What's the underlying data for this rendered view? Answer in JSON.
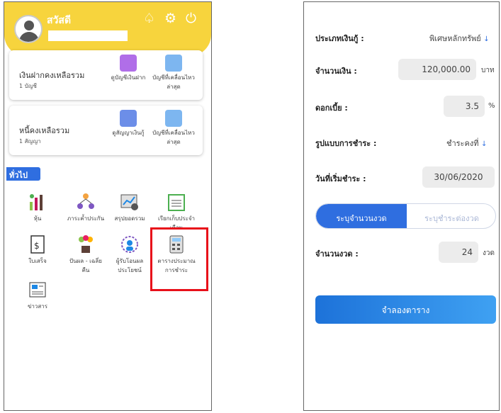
{
  "left": {
    "greeting": "สวัสดี",
    "header_icons": [
      "bell-icon",
      "gear-icon",
      "power-icon"
    ],
    "deposit_card": {
      "title": "เงินฝากคงเหลือรวม",
      "subtitle": "1 บัญชี",
      "action1": "ดูบัญชีเงินฝาก",
      "action2_line1": "บัญชีที่เคลื่อนไหว",
      "action2_line2": "ล่าสุด"
    },
    "loan_card": {
      "title": "หนี้คงเหลือรวม",
      "subtitle": "1 สัญญา",
      "action1": "ดูสัญญาเงินกู้",
      "action2_line1": "บัญชีที่เคลื่อนไหว",
      "action2_line2": "ล่าสุด"
    },
    "section_label": "ทั่วไป",
    "menu": [
      {
        "l1": "หุ้น",
        "l2": ""
      },
      {
        "l1": "ภาระค้ำประกัน",
        "l2": ""
      },
      {
        "l1": "สรุปยอดรวม",
        "l2": ""
      },
      {
        "l1": "เรียกเก็บประจำ",
        "l2": "เดือน"
      },
      {
        "l1": "ใบเสร็จ",
        "l2": ""
      },
      {
        "l1": "ปันผล - เฉลี่ย",
        "l2": "คืน"
      },
      {
        "l1": "ผู้รับโอนผล",
        "l2": "ประโยชน์"
      },
      {
        "l1": "ตารางประมาณ",
        "l2": "การชำระ"
      },
      {
        "l1": "ข่าวสาร",
        "l2": ""
      }
    ]
  },
  "right": {
    "loan_type_label": "ประเภทเงินกู้ :",
    "loan_type_value": "พิเศษหลักทรัพย์",
    "amount_label": "จำนวนเงิน :",
    "amount_value": "120,000.00",
    "amount_unit": "บาท",
    "interest_label": "ดอกเบี้ย :",
    "interest_value": "3.5",
    "interest_unit": "%",
    "pay_type_label": "รูปแบบการชำระ :",
    "pay_type_value": "ชำระคงที่",
    "start_label": "วันที่เริ่มชำระ :",
    "start_value": "30/06/2020",
    "toggle_on": "ระบุจำนวนงวด",
    "toggle_off": "ระบุชำระต่องวด",
    "installments_label": "จำนวนงวด :",
    "installments_value": "24",
    "installments_unit": "งวด",
    "simulate_button": "จำลองตาราง"
  }
}
